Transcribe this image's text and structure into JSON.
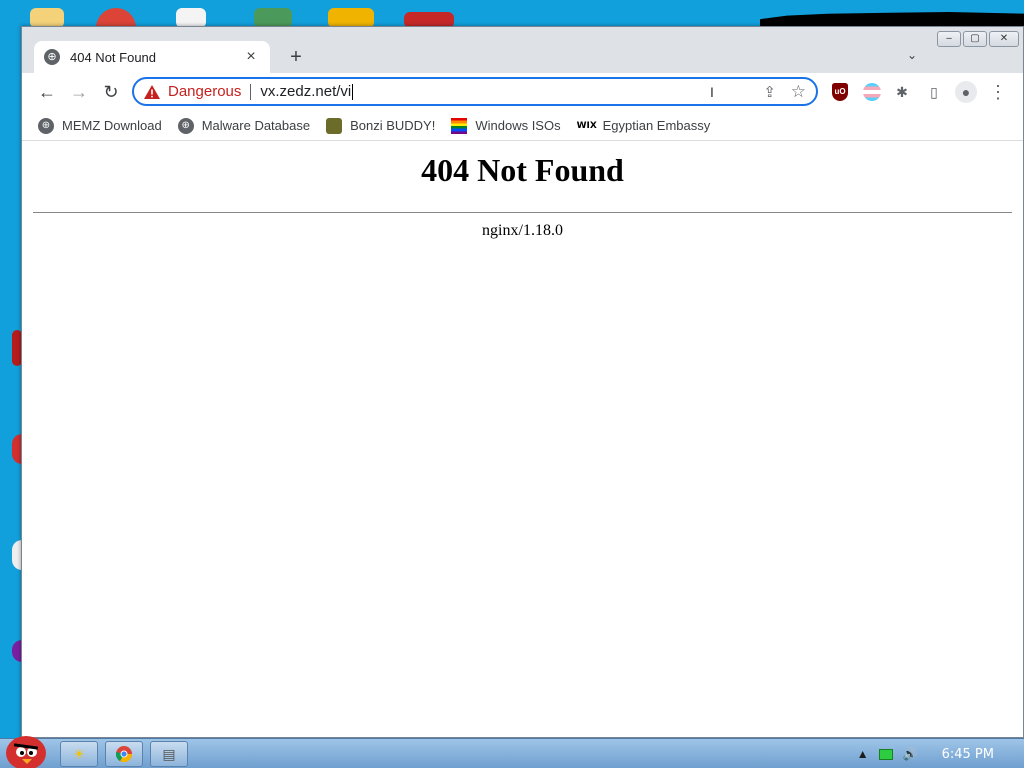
{
  "browser": {
    "tab": {
      "title": "404 Not Found",
      "close": "×"
    },
    "new_tab": "+",
    "tab_search": "⌄",
    "window_controls": {
      "minimize": "‒",
      "maximize": "▢",
      "close": "✕"
    },
    "nav": {
      "back": "←",
      "forward": "→",
      "reload": "↻"
    },
    "omnibox": {
      "security_label": "Dangerous",
      "url": "vx.zedz.net/vi",
      "share": "⇪",
      "bookmark": "☆"
    },
    "extensions": {
      "ublock": "uO",
      "puzzle": "✱",
      "sidepanel": "▯",
      "profile": "●",
      "menu": "⋮"
    }
  },
  "bookmarks": [
    {
      "label": "MEMZ Download",
      "icon": "globe-icon"
    },
    {
      "label": "Malware Database",
      "icon": "globe-icon"
    },
    {
      "label": "Bonzi BUDDY!",
      "icon": "bonzi-icon"
    },
    {
      "label": "Windows ISOs",
      "icon": "rainbow-flag-icon"
    },
    {
      "label": "Egyptian Embassy",
      "icon": "wix-icon",
      "icon_text": "WIX"
    }
  ],
  "page": {
    "heading": "404 Not Found",
    "server": "nginx/1.18.0"
  },
  "taskbar": {
    "clock": "6:45 PM",
    "tray_up": "▲",
    "volume": "🔊"
  },
  "colors": {
    "desktop": "#12a0dc",
    "danger": "#c5221f",
    "omnibox_focus": "#1a73e8"
  }
}
